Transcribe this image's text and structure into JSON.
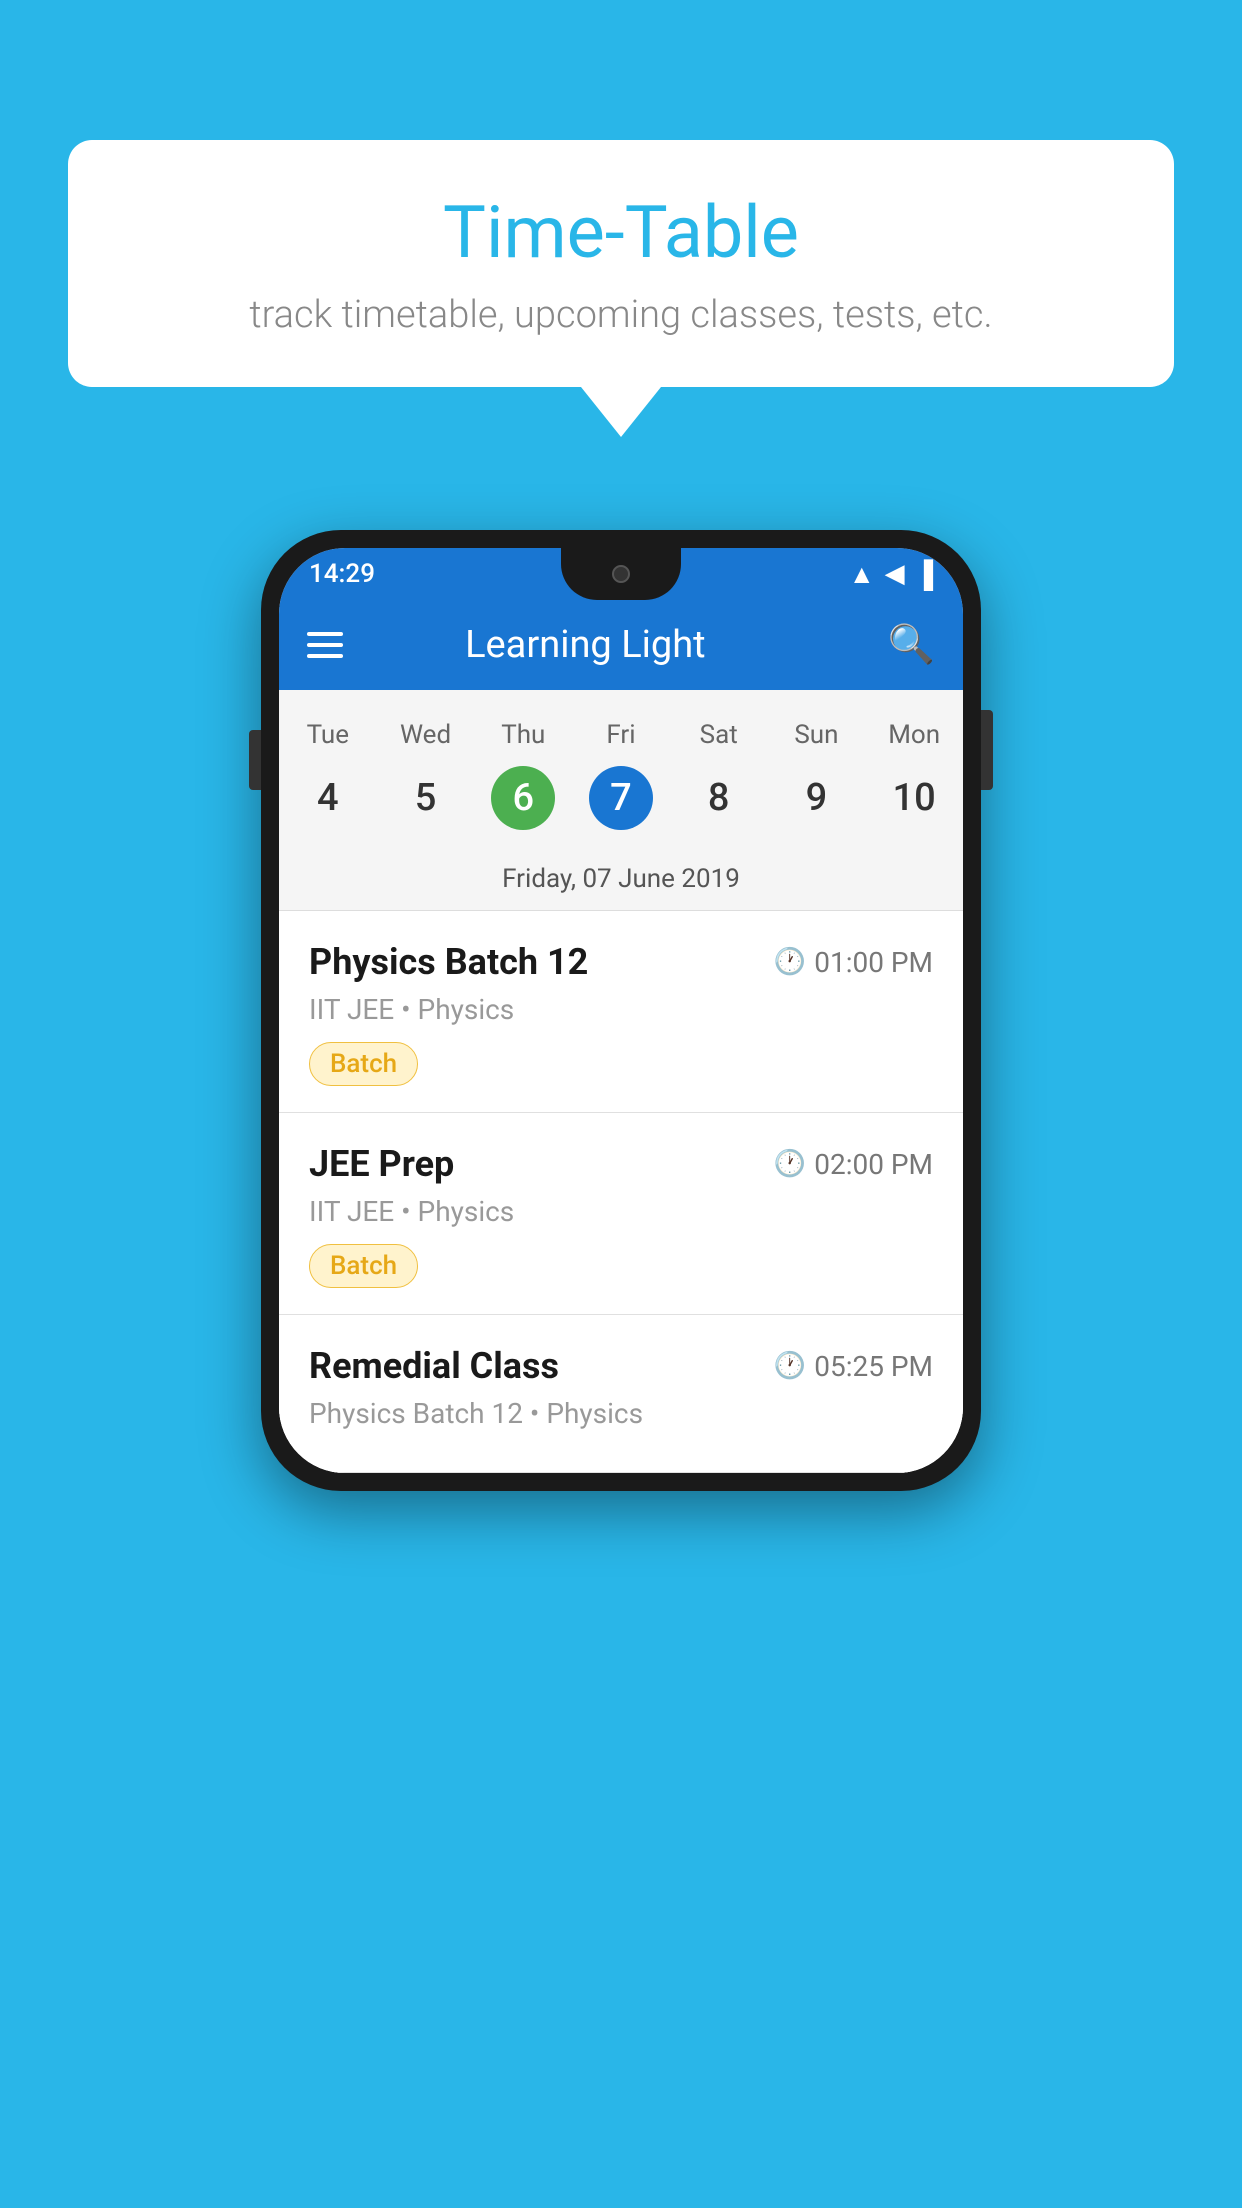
{
  "background_color": "#29b6e8",
  "speech_bubble": {
    "title": "Time-Table",
    "subtitle": "track timetable, upcoming classes, tests, etc."
  },
  "phone": {
    "status_bar": {
      "time": "14:29",
      "icons": [
        "wifi",
        "signal",
        "battery"
      ]
    },
    "app_bar": {
      "title": "Learning Light",
      "menu_icon": "hamburger",
      "search_icon": "search"
    },
    "calendar": {
      "days": [
        "Tue",
        "Wed",
        "Thu",
        "Fri",
        "Sat",
        "Sun",
        "Mon"
      ],
      "dates": [
        "4",
        "5",
        "6",
        "7",
        "8",
        "9",
        "10"
      ],
      "today_index": 2,
      "selected_index": 3,
      "selected_label": "Friday, 07 June 2019"
    },
    "schedule": [
      {
        "title": "Physics Batch 12",
        "time": "01:00 PM",
        "subtitle": "IIT JEE • Physics",
        "badge": "Batch",
        "badge_type": "batch"
      },
      {
        "title": "JEE Prep",
        "time": "02:00 PM",
        "subtitle": "IIT JEE • Physics",
        "badge": "Batch",
        "badge_type": "batch"
      },
      {
        "title": "Remedial Class",
        "time": "05:25 PM",
        "subtitle": "Physics Batch 12 • Physics",
        "badge": null,
        "badge_type": null
      }
    ]
  }
}
